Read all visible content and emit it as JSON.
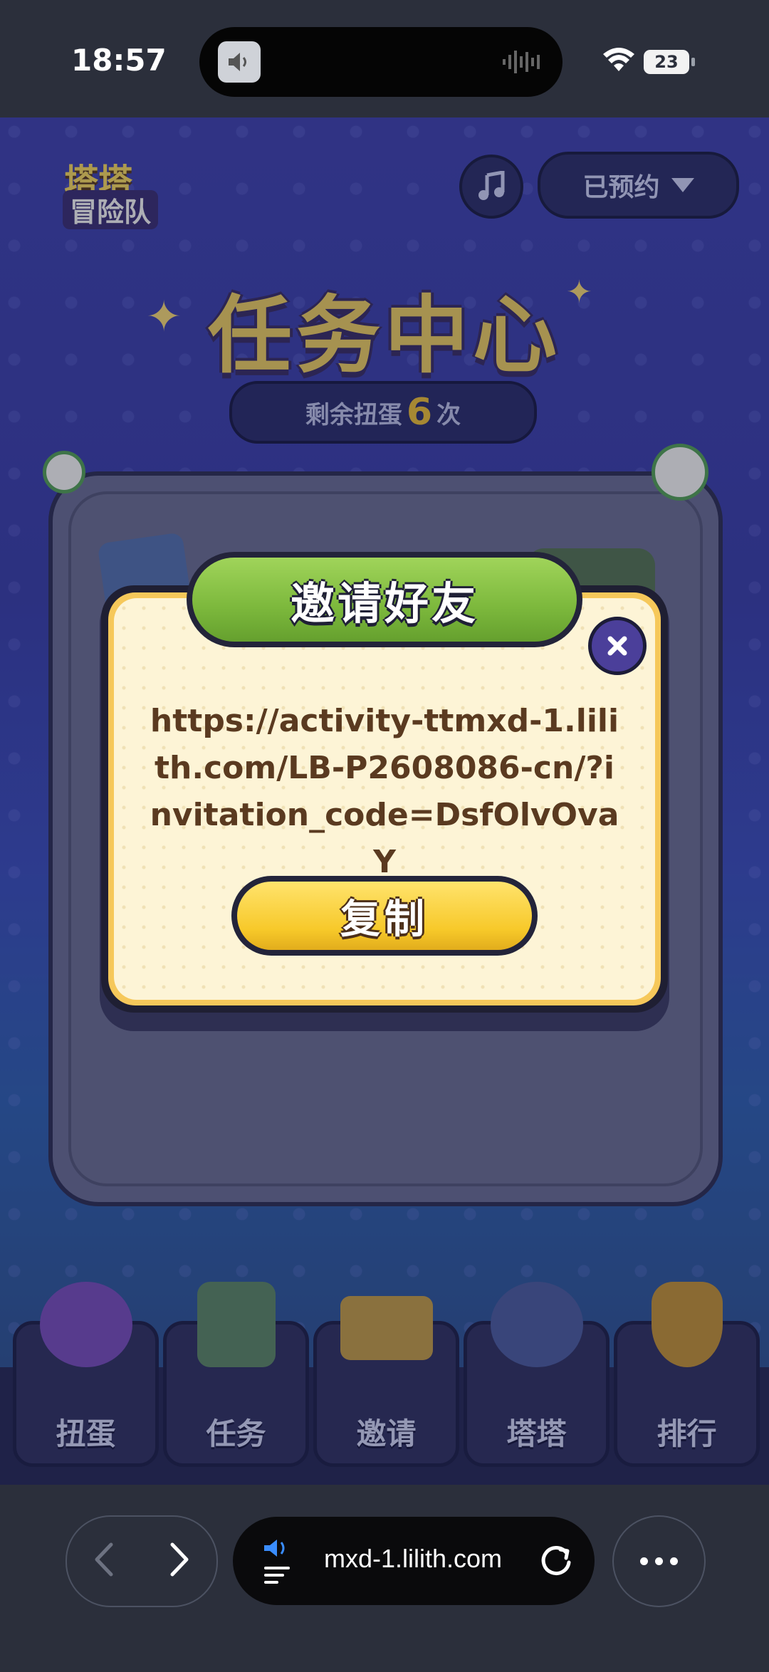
{
  "status_bar": {
    "time": "18:57",
    "battery": "23"
  },
  "game": {
    "logo_line1": "塔塔",
    "logo_line2": "冒险队",
    "reserve_label": "已预约",
    "page_title": "任务中心",
    "remaining_prefix": "剩余扭蛋",
    "remaining_count": "6",
    "remaining_suffix": "次"
  },
  "modal": {
    "title": "邀请好友",
    "invite_url": "https://activity-ttmxd-1.lilith.com/LB-P2608086-cn/?invitation_code=DsfOlvOvaY",
    "copy_label": "复制"
  },
  "bottom_nav": {
    "items": [
      {
        "label": "扭蛋"
      },
      {
        "label": "任务"
      },
      {
        "label": "邀请"
      },
      {
        "label": "塔塔"
      },
      {
        "label": "排行"
      }
    ]
  },
  "browser": {
    "url_display": "mxd-1.lilith.com"
  },
  "colors": {
    "game_bg": "#3f43b6",
    "modal_header": "#7cb83c",
    "copy_button": "#f7c92a",
    "url_text": "#5a3a20"
  }
}
